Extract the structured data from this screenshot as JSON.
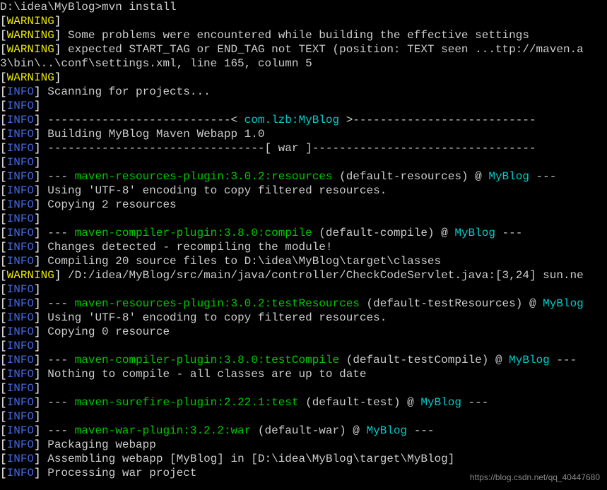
{
  "prompt": "D:\\idea\\MyBlog>mvn install",
  "lines": [
    {
      "type": "warning",
      "text": ""
    },
    {
      "type": "warning",
      "text": " Some problems were encountered while building the effective settings"
    },
    {
      "type": "warning",
      "text": " expected START_TAG or END_TAG not TEXT (position: TEXT seen ...ttp://maven.a"
    },
    {
      "type": "plain",
      "text": "3\\bin\\..\\conf\\settings.xml, line 165, column 5"
    },
    {
      "type": "warning",
      "text": ""
    },
    {
      "type": "info",
      "text": " Scanning for projects..."
    },
    {
      "type": "info",
      "text": ""
    },
    {
      "type": "info-banner",
      "pre": " ---------------------------< ",
      "mid": "com.lzb:MyBlog",
      "post": " >---------------------------"
    },
    {
      "type": "info",
      "text": " Building MyBlog Maven Webapp 1.0"
    },
    {
      "type": "info",
      "text": " --------------------------------[ war ]---------------------------------"
    },
    {
      "type": "info",
      "text": ""
    },
    {
      "type": "info-plugin",
      "pre": " --- ",
      "plugin": "maven-resources-plugin:3.0.2:resources",
      "goal": " (default-resources) @ ",
      "project": "MyBlog",
      "post": " ---"
    },
    {
      "type": "info",
      "text": " Using 'UTF-8' encoding to copy filtered resources."
    },
    {
      "type": "info",
      "text": " Copying 2 resources"
    },
    {
      "type": "info",
      "text": ""
    },
    {
      "type": "info-plugin",
      "pre": " --- ",
      "plugin": "maven-compiler-plugin:3.8.0:compile",
      "goal": " (default-compile) @ ",
      "project": "MyBlog",
      "post": " ---"
    },
    {
      "type": "info",
      "text": " Changes detected - recompiling the module!"
    },
    {
      "type": "info",
      "text": " Compiling 20 source files to D:\\idea\\MyBlog\\target\\classes"
    },
    {
      "type": "warning",
      "text": " /D:/idea/MyBlog/src/main/java/controller/CheckCodeServlet.java:[3,24] sun.ne"
    },
    {
      "type": "info",
      "text": ""
    },
    {
      "type": "info-plugin",
      "pre": " --- ",
      "plugin": "maven-resources-plugin:3.0.2:testResources",
      "goal": " (default-testResources) @ ",
      "project": "MyBlog",
      "post": ""
    },
    {
      "type": "info",
      "text": " Using 'UTF-8' encoding to copy filtered resources."
    },
    {
      "type": "info",
      "text": " Copying 0 resource"
    },
    {
      "type": "info",
      "text": ""
    },
    {
      "type": "info-plugin",
      "pre": " --- ",
      "plugin": "maven-compiler-plugin:3.8.0:testCompile",
      "goal": " (default-testCompile) @ ",
      "project": "MyBlog",
      "post": " ---"
    },
    {
      "type": "info",
      "text": " Nothing to compile - all classes are up to date"
    },
    {
      "type": "info",
      "text": ""
    },
    {
      "type": "info-plugin",
      "pre": " --- ",
      "plugin": "maven-surefire-plugin:2.22.1:test",
      "goal": " (default-test) @ ",
      "project": "MyBlog",
      "post": " ---"
    },
    {
      "type": "info",
      "text": ""
    },
    {
      "type": "info-plugin",
      "pre": " --- ",
      "plugin": "maven-war-plugin:3.2.2:war",
      "goal": " (default-war) @ ",
      "project": "MyBlog",
      "post": " ---"
    },
    {
      "type": "info",
      "text": " Packaging webapp"
    },
    {
      "type": "info",
      "text": " Assembling webapp [MyBlog] in [D:\\idea\\MyBlog\\target\\MyBlog]"
    },
    {
      "type": "info",
      "text": " Processing war project"
    }
  ],
  "labels": {
    "info": "INFO",
    "warning": "WARNING"
  },
  "watermark": "https://blog.csdn.net/qq_40447680"
}
